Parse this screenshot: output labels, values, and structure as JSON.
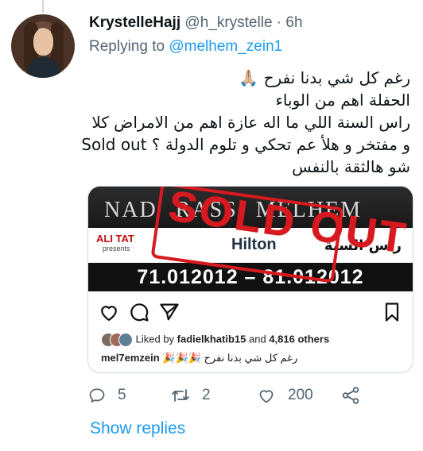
{
  "author": {
    "display_name": "KrystelleHajj",
    "handle": "@h_krystelle",
    "separator": "·",
    "time": "6h"
  },
  "reply": {
    "prefix": "Replying to",
    "target": "@melhem_zein1"
  },
  "tweet": {
    "lines": [
      "رغم كل شي بدنا نفرح 🙏🏼",
      "الحفلة اهم من الوباء",
      "راس السنة اللي ما اله عازة اهم من الامراض كلا",
      "و مفتخر و هلأ عم تحكي و تلوم الدولة ؟ Sold out",
      "شو هالثقة بالنفس"
    ]
  },
  "instagram_card": {
    "promo": {
      "names": [
        "NAD",
        "RASS",
        "MELHEM"
      ],
      "presenter": "ALI TAT",
      "presenter_sub": "presents",
      "hotel": "Hilton",
      "arabic_label": "راس السنة",
      "dates": "71.012012 – 81.012012",
      "stamp": "SOLD OUT"
    },
    "liked_by_label": "Liked by",
    "liked_by_user": "fadielkhatib15",
    "and_label": "and",
    "others_count": "4,816 others",
    "caption_user": "mel7emzein",
    "caption_text": "🎉🎉🎉 رغم كل شي بدنا نفرح"
  },
  "actions": {
    "replies": "5",
    "retweets": "2",
    "likes": "200"
  },
  "show_replies_label": "Show replies",
  "colors": {
    "accent": "#1d9bf0",
    "muted": "#536471",
    "stamp": "#d71920"
  }
}
